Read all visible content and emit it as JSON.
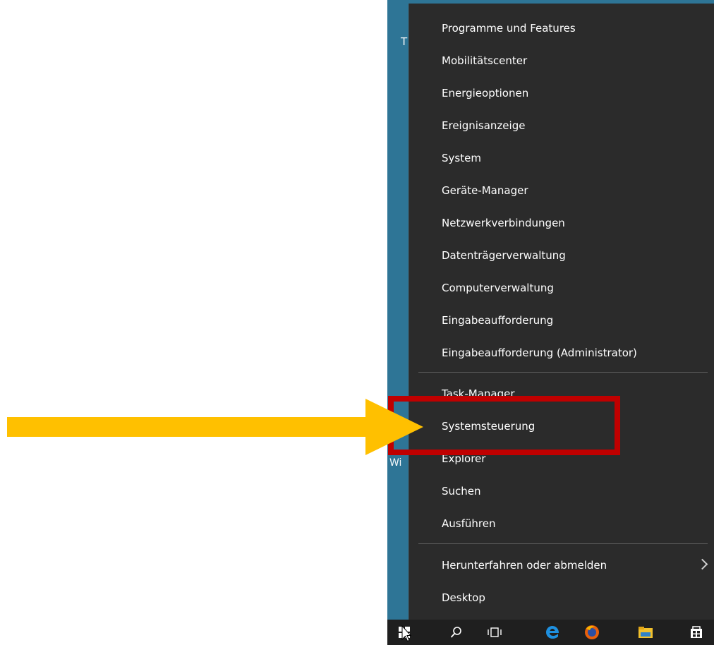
{
  "desktop": {
    "partial_text_top": "T",
    "partial_text_mid": "Wi"
  },
  "menu": {
    "items": [
      {
        "label": "Programme und Features"
      },
      {
        "label": "Mobilitätscenter"
      },
      {
        "label": "Energieoptionen"
      },
      {
        "label": "Ereignisanzeige"
      },
      {
        "label": "System"
      },
      {
        "label": "Geräte-Manager"
      },
      {
        "label": "Netzwerkverbindungen"
      },
      {
        "label": "Datenträgerverwaltung"
      },
      {
        "label": "Computerverwaltung"
      },
      {
        "label": "Eingabeaufforderung"
      },
      {
        "label": "Eingabeaufforderung (Administrator)"
      },
      {
        "label": "Task-Manager"
      },
      {
        "label": "Systemsteuerung"
      },
      {
        "label": "Explorer"
      },
      {
        "label": "Suchen"
      },
      {
        "label": "Ausführen"
      },
      {
        "label": "Herunterfahren oder abmelden",
        "submenu": true
      },
      {
        "label": "Desktop"
      }
    ]
  },
  "annotation": {
    "highlighted_item": "Systemsteuerung",
    "arrow_color": "#ffc000",
    "box_color": "#c00000"
  },
  "taskbar": {
    "icons": [
      "windows-start-icon",
      "search-icon",
      "task-view-icon",
      "edge-icon",
      "firefox-icon",
      "file-explorer-icon",
      "store-icon"
    ]
  }
}
